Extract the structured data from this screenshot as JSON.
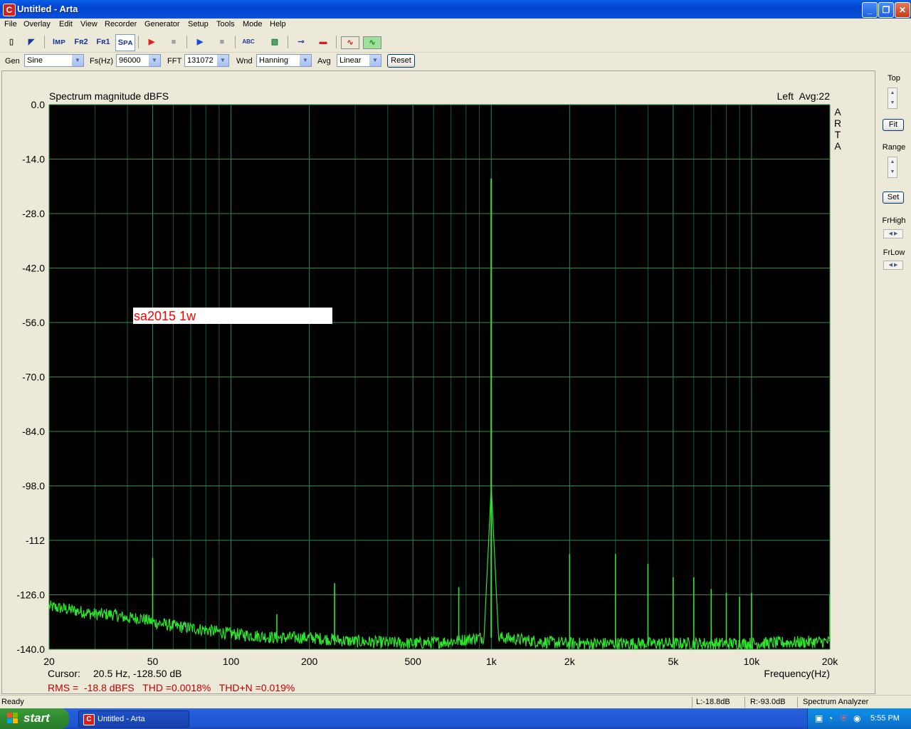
{
  "window": {
    "title": "Untitled - Arta",
    "app_icon_glyph": "C"
  },
  "menu": [
    "File",
    "Overlay",
    "Edit",
    "View",
    "Recorder",
    "Generator",
    "Setup",
    "Tools",
    "Mode",
    "Help"
  ],
  "toolbar": {
    "buttons": [
      {
        "name": "new-file",
        "label": "▯"
      },
      {
        "name": "open-file",
        "label": "◤"
      },
      {
        "name": "imp",
        "label": "Iᴍᴘ"
      },
      {
        "name": "fr2",
        "label": "Fʀ2"
      },
      {
        "name": "fr1",
        "label": "Fʀ1"
      },
      {
        "name": "spa",
        "label": "Sᴘᴀ"
      },
      {
        "name": "record",
        "label": "▶"
      },
      {
        "name": "stop-record",
        "label": "■"
      },
      {
        "name": "play",
        "label": "▶"
      },
      {
        "name": "stop-play",
        "label": "■"
      },
      {
        "name": "abc",
        "label": "ABC"
      },
      {
        "name": "grid",
        "label": "▧"
      },
      {
        "name": "slider",
        "label": "⊸"
      },
      {
        "name": "meter",
        "label": "▬"
      },
      {
        "name": "generator-wave",
        "label": "∿"
      },
      {
        "name": "scope",
        "label": "∿"
      }
    ]
  },
  "params": {
    "gen_label": "Gen",
    "gen_value": "Sine",
    "fs_label": "Fs(Hz)",
    "fs_value": "96000",
    "fft_label": "FFT",
    "fft_value": "131072",
    "wnd_label": "Wnd",
    "wnd_value": "Hanning",
    "avg_label": "Avg",
    "avg_value": "Linear",
    "reset_label": "Reset"
  },
  "side": {
    "top_label": "Top",
    "fit_label": "Fit",
    "range_label": "Range",
    "set_label": "Set",
    "frhigh_label": "FrHigh",
    "frlow_label": "FrLow"
  },
  "info": {
    "cursor_label": "Cursor:",
    "cursor_value": "20.5 Hz, -128.50 dB",
    "measurements": "RMS =  -18.8 dBFS   THD =0.0018%   THD+N =0.019%"
  },
  "status": {
    "ready": "Ready",
    "left_level": "L:-18.8dB",
    "right_level": "R:-93.0dB",
    "mode": "Spectrum Analyzer"
  },
  "taskbar": {
    "start": "start",
    "task": "Untitled - Arta",
    "clock": "5:55 PM"
  },
  "colors": {
    "trace": "#2ce62c",
    "plot_bg": "#000000",
    "grid": "#1f6b3a",
    "annotation": "#ff0000",
    "measure_text": "#c00000"
  },
  "chart_data": {
    "type": "line",
    "title": "Spectrum magnitude dBFS",
    "channel": "Left",
    "avg": "Avg:22",
    "side_text": [
      "A",
      "R",
      "T",
      "A"
    ],
    "annotation": "sa2015 1w",
    "xlabel": "Frequency(Hz)",
    "ylabel": "",
    "x_scale": "log",
    "xlim": [
      20,
      20000
    ],
    "ylim": [
      -140,
      0
    ],
    "y_ticks": [
      "0.0",
      "-14.0",
      "-28.0",
      "-42.0",
      "-56.0",
      "-70.0",
      "-84.0",
      "-98.0",
      "-112",
      "-126.0",
      "-140.0"
    ],
    "x_tick_labels": [
      {
        "v": 20,
        "t": "20"
      },
      {
        "v": 50,
        "t": "50"
      },
      {
        "v": 100,
        "t": "100"
      },
      {
        "v": 200,
        "t": "200"
      },
      {
        "v": 500,
        "t": "500"
      },
      {
        "v": 1000,
        "t": "1k"
      },
      {
        "v": 2000,
        "t": "2k"
      },
      {
        "v": 5000,
        "t": "5k"
      },
      {
        "v": 10000,
        "t": "10k"
      },
      {
        "v": 20000,
        "t": "20k"
      }
    ],
    "grid": true,
    "noise_floor": [
      [
        20,
        -129
      ],
      [
        25,
        -130
      ],
      [
        30,
        -131
      ],
      [
        35,
        -131
      ],
      [
        40,
        -132
      ],
      [
        45,
        -132
      ],
      [
        50,
        -133
      ],
      [
        60,
        -134
      ],
      [
        80,
        -135
      ],
      [
        100,
        -136
      ],
      [
        150,
        -137
      ],
      [
        200,
        -137
      ],
      [
        300,
        -138
      ],
      [
        500,
        -138.5
      ],
      [
        700,
        -138
      ],
      [
        900,
        -137
      ],
      [
        1100,
        -137
      ],
      [
        1500,
        -138
      ],
      [
        2000,
        -138.5
      ],
      [
        5000,
        -138.5
      ],
      [
        10000,
        -138.5
      ],
      [
        20000,
        -138
      ]
    ],
    "peaks": [
      {
        "f": 1000,
        "db": -19
      },
      {
        "f": 50,
        "db": -116.5
      },
      {
        "f": 150,
        "db": -131
      },
      {
        "f": 250,
        "db": -123
      },
      {
        "f": 750,
        "db": -124
      },
      {
        "f": 2000,
        "db": -115.5
      },
      {
        "f": 3000,
        "db": -115.5
      },
      {
        "f": 4000,
        "db": -118
      },
      {
        "f": 5000,
        "db": -121.5
      },
      {
        "f": 6000,
        "db": -121.5
      },
      {
        "f": 7000,
        "db": -124.5
      },
      {
        "f": 8000,
        "db": -125.5
      },
      {
        "f": 9000,
        "db": -126.5
      },
      {
        "f": 10000,
        "db": -125.5
      },
      {
        "f": 20000,
        "db": -126
      }
    ]
  }
}
